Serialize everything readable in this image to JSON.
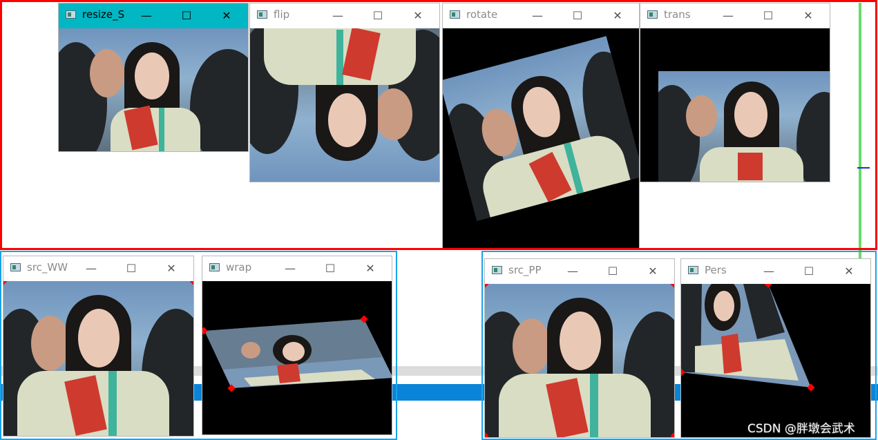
{
  "windows": {
    "resize": {
      "title": "resize_S",
      "active": true
    },
    "flip": {
      "title": "flip"
    },
    "rotate": {
      "title": "rotate"
    },
    "trans": {
      "title": "trans"
    },
    "src_ww": {
      "title": "src_WW"
    },
    "wrap": {
      "title": "wrap"
    },
    "src_pp": {
      "title": "src_PP"
    },
    "pers": {
      "title": "Pers"
    }
  },
  "controls": {
    "minimize": "—",
    "maximize": "☐",
    "close": "✕"
  },
  "watermark": "CSDN @胖墩会武术",
  "colors": {
    "active_titlebar": "#00b7c3",
    "red_frame": "#ff0000",
    "blue_frame": "#1aa3e8",
    "green_bar": "#66dd66",
    "taskbar_blue": "#0a84d8"
  }
}
